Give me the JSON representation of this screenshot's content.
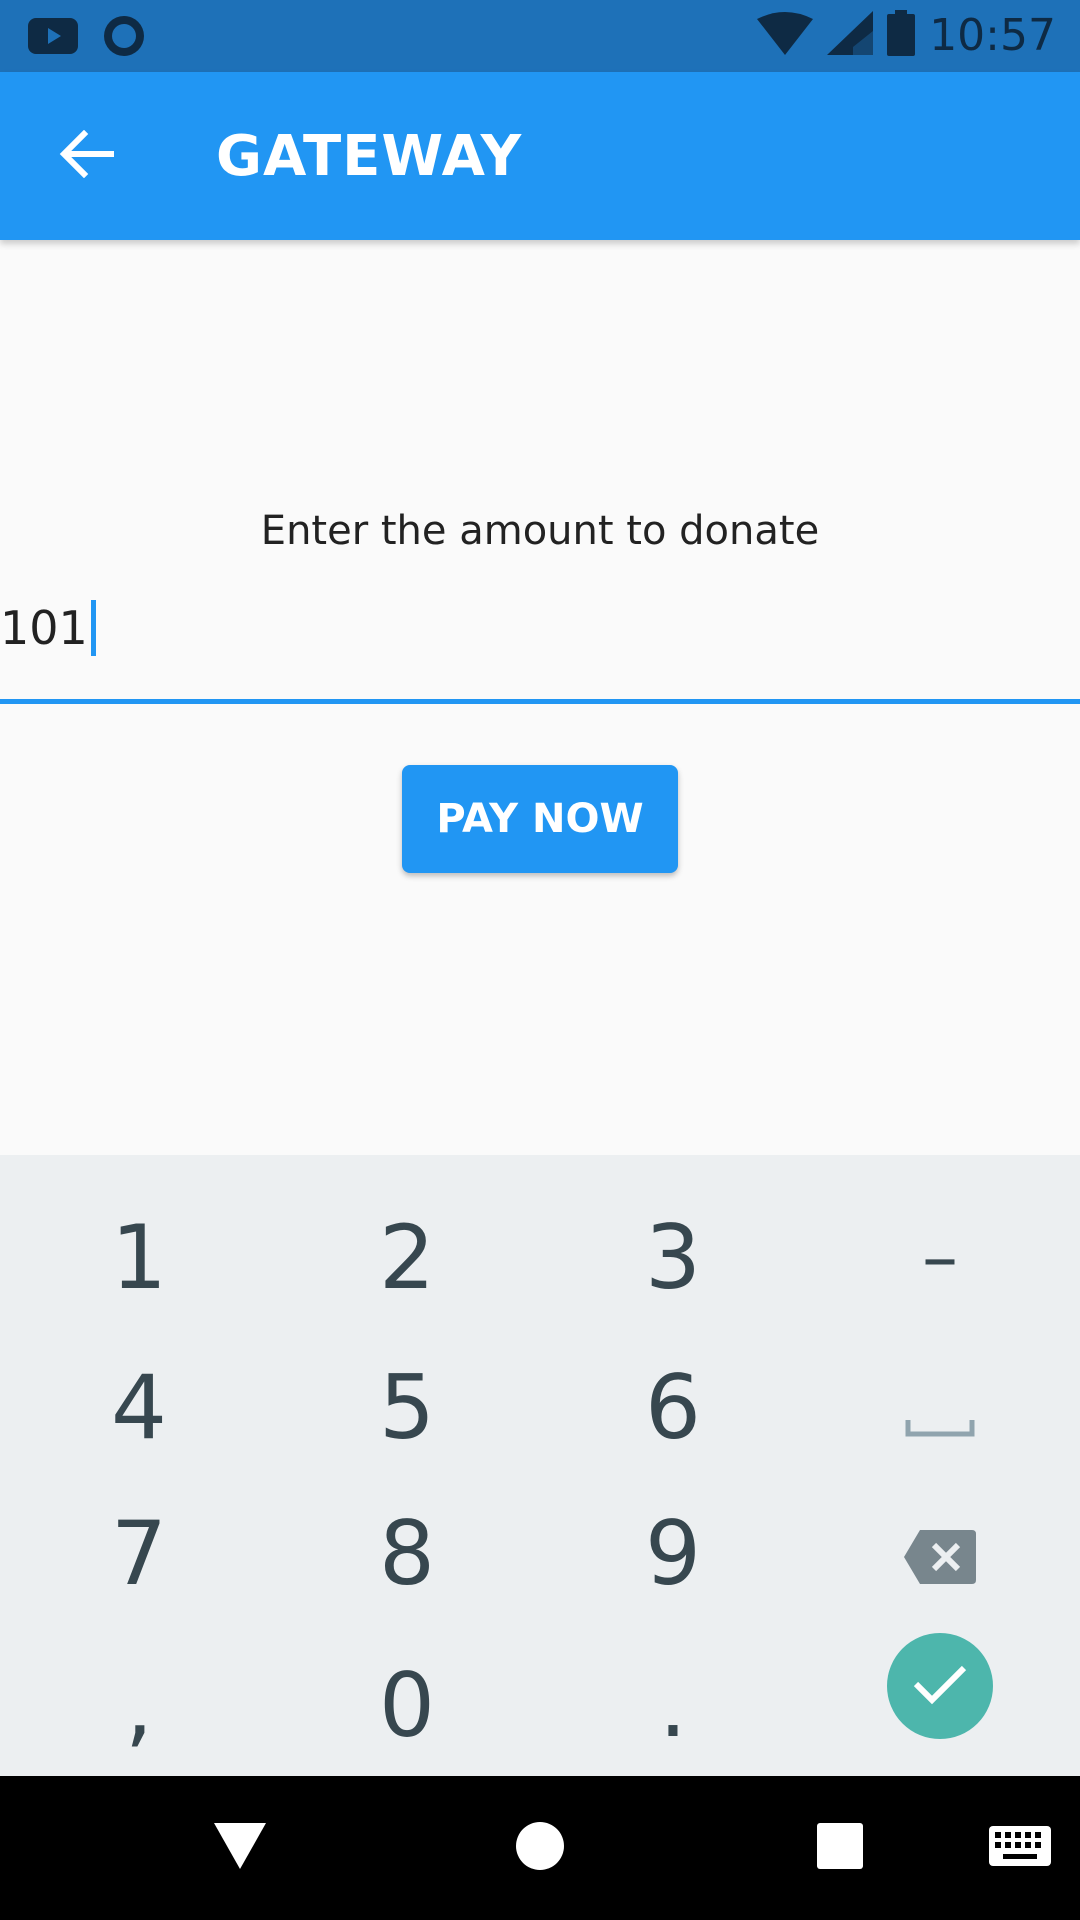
{
  "status_bar": {
    "time": "10:57",
    "icons": [
      "youtube-icon",
      "circle-notification-icon",
      "wifi-icon",
      "signal-icon",
      "battery-icon"
    ]
  },
  "app_bar": {
    "title": "GATEWAY",
    "back_icon": "arrow-back-icon"
  },
  "form": {
    "prompt": "Enter the amount to donate",
    "amount_value": "101"
  },
  "pay_button": {
    "label": "PAY NOW"
  },
  "keyboard": {
    "keys": [
      [
        "1",
        "2",
        "3",
        "–"
      ],
      [
        "4",
        "5",
        "6",
        "space"
      ],
      [
        "7",
        "8",
        "9",
        "backspace"
      ],
      [
        ",",
        "0",
        ".",
        "done"
      ]
    ]
  },
  "nav_bar": {
    "icons": [
      "back-triangle-icon",
      "home-circle-icon",
      "recents-square-icon",
      "keyboard-icon"
    ]
  },
  "colors": {
    "primary": "#2196f3",
    "status_bar": "#1e71b8",
    "done_key": "#4db6ac",
    "keyboard_bg": "#eceff1"
  }
}
